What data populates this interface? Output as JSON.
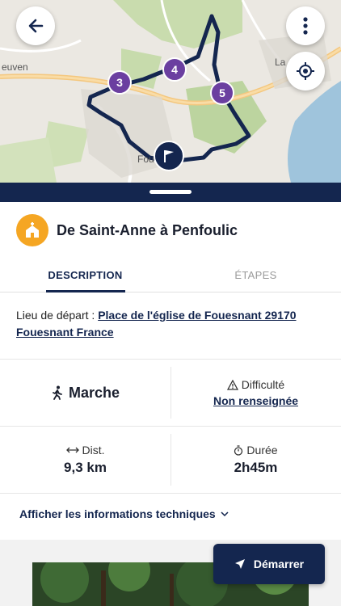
{
  "map": {
    "labels": [
      "euven",
      "La",
      "Fou"
    ],
    "markers": [
      "3",
      "4",
      "5"
    ],
    "colors": {
      "route": "#14264f",
      "marker": "#6b3fa0"
    }
  },
  "header": {
    "back_icon": "arrow-left-icon",
    "menu_icon": "more-vertical-icon",
    "locate_icon": "crosshair-icon"
  },
  "poi": {
    "icon": "chapel-icon",
    "title": "De Saint-Anne à Penfoulic"
  },
  "tabs": [
    {
      "label": "DESCRIPTION",
      "active": true
    },
    {
      "label": "ÉTAPES",
      "active": false
    }
  ],
  "departure": {
    "prefix": "Lieu de départ : ",
    "place": "Place de l'église de Fouesnant 29170 Fouesnant France"
  },
  "info": {
    "mode": "Marche",
    "difficulty_label": "Difficulté",
    "difficulty_value": "Non renseignée",
    "distance_label": "Dist.",
    "distance_value": "9,3 km",
    "duration_label": "Durée",
    "duration_value": "2h45m"
  },
  "tech_link": "Afficher les informations techniques",
  "start_button": "Démarrer"
}
